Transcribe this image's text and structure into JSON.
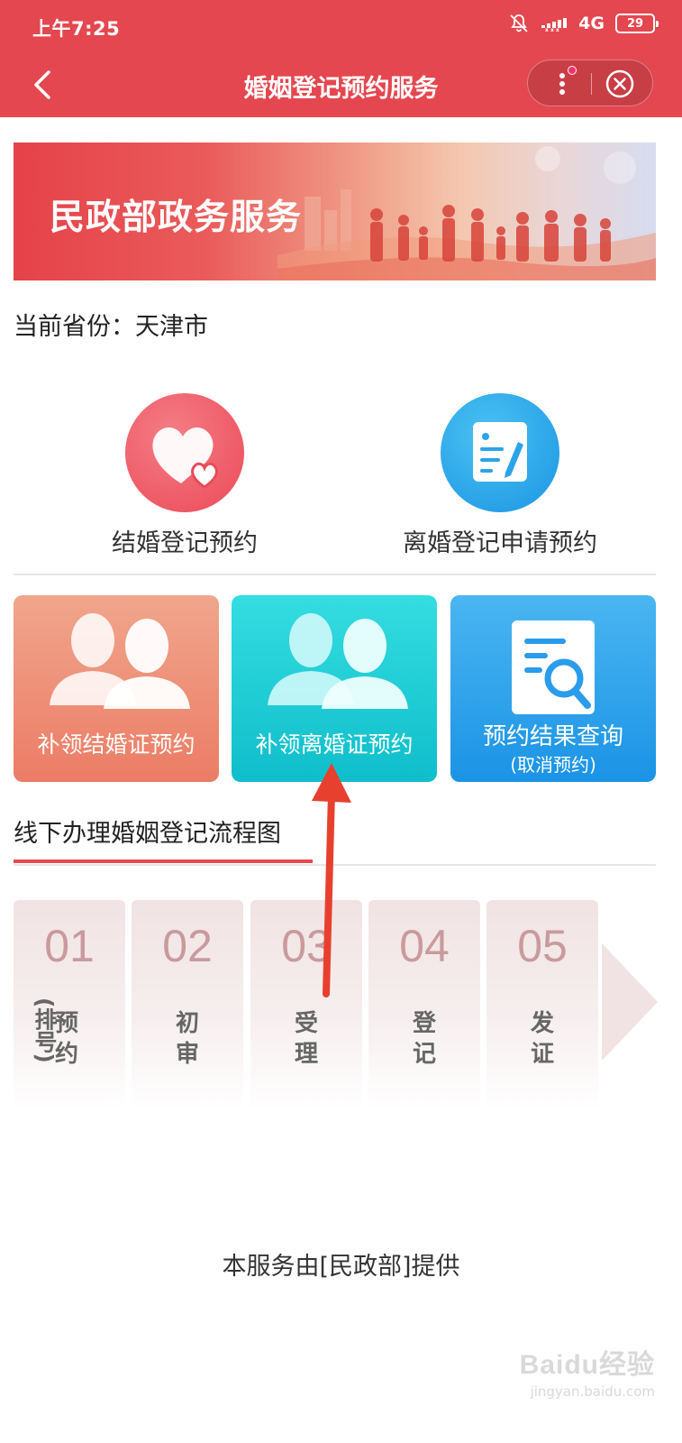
{
  "status_bar": {
    "time": "上午7:25",
    "network": "4G",
    "battery": "29",
    "icons": [
      "bell-muted-icon",
      "signal-icon",
      "battery-icon"
    ]
  },
  "header": {
    "title": "婚姻登记预约服务",
    "back_icon": "chevron-left-icon",
    "more_icon": "more-vertical-icon",
    "close_icon": "close-circle-icon"
  },
  "banner": {
    "title": "民政部政务服务"
  },
  "province": {
    "text": "当前省份：天津市"
  },
  "services": {
    "marriage": {
      "label": "结婚登记预约",
      "icon": "heart-icon",
      "color": "#ea4a57"
    },
    "divorce": {
      "label": "离婚登记申请预约",
      "icon": "form-edit-icon",
      "color": "#1a94e4"
    }
  },
  "cards": [
    {
      "label": "补领结婚证预约",
      "icon": "couple-icon",
      "color": "#ec7c66"
    },
    {
      "label": "补领离婚证预约",
      "icon": "couple-icon",
      "color": "#0fbecb"
    },
    {
      "label": "预约结果查询",
      "sub": "(取消预约)",
      "icon": "document-search-icon",
      "color": "#1b93e5"
    }
  ],
  "flow": {
    "title": "线下办理婚姻登记流程图",
    "steps": [
      {
        "num": "01",
        "name": "预约",
        "note": "(排号)"
      },
      {
        "num": "02",
        "name": "初审"
      },
      {
        "num": "03",
        "name": "受理"
      },
      {
        "num": "04",
        "name": "登记"
      },
      {
        "num": "05",
        "name": "发证"
      }
    ]
  },
  "footer": {
    "provider": "本服务由[民政部]提供"
  },
  "watermark": {
    "brand": "Baidu经验",
    "url": "jingyan.baidu.com"
  },
  "colors": {
    "header": "#e4474f",
    "accent": "#e84a50"
  }
}
